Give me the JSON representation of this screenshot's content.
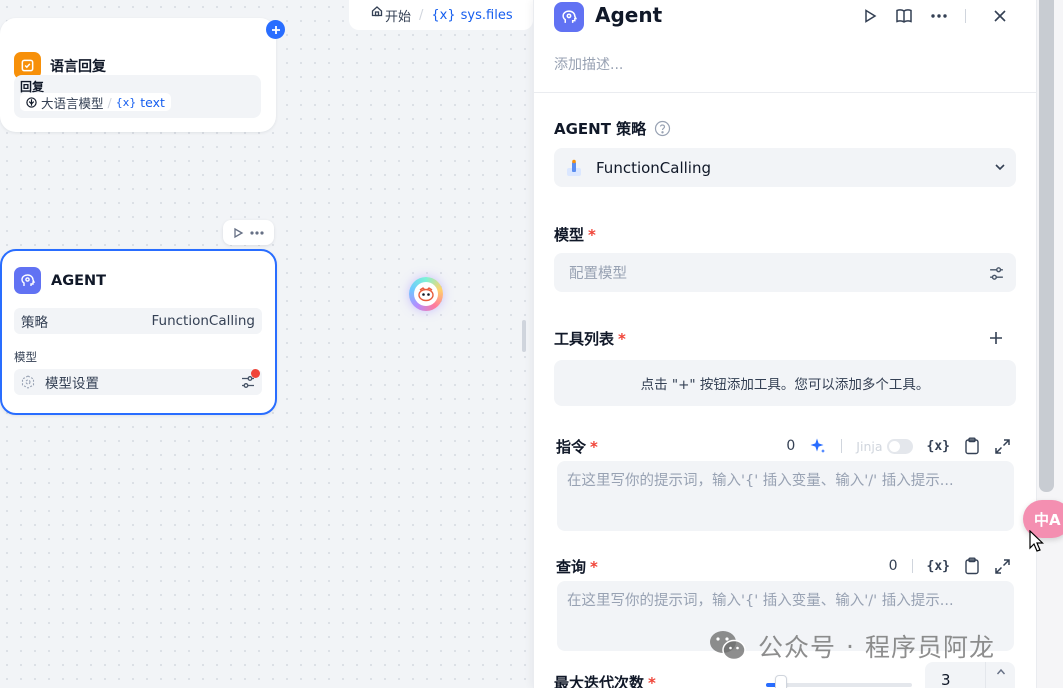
{
  "canvas": {
    "reply_node": {
      "title": "语言回复",
      "reply_label": "回复",
      "source_node": "大语言模型",
      "separator": "/",
      "variable_prefix": "{x}",
      "variable": "text"
    },
    "start_crumb": {
      "label": "开始",
      "separator": "/",
      "variable_prefix": "{x}",
      "variable": "sys.files"
    },
    "agent_node": {
      "title": "AGENT",
      "strategy_label": "策略",
      "strategy_value": "FunctionCalling",
      "model_label": "模型",
      "model_value": "模型设置"
    }
  },
  "panel": {
    "title": "Agent",
    "description_placeholder": "添加描述...",
    "strategy": {
      "label": "AGENT 策略",
      "value": "FunctionCalling"
    },
    "model": {
      "label": "模型",
      "required": "*",
      "placeholder": "配置模型"
    },
    "tools": {
      "label": "工具列表",
      "required": "*",
      "empty_text": "点击 \"+\" 按钮添加工具。您可以添加多个工具。"
    },
    "instruction": {
      "label": "指令",
      "required": "*",
      "count": "0",
      "jinja_label": "Jinja",
      "var_button": "{x}",
      "placeholder": "在这里写你的提示词，输入'{' 插入变量、输入'/' 插入提示..."
    },
    "query": {
      "label": "查询",
      "required": "*",
      "count": "0",
      "var_button": "{x}",
      "placeholder": "在这里写你的提示词，输入'{' 插入变量、输入'/' 插入提示..."
    },
    "max_iterations": {
      "label": "最大迭代次数",
      "required": "*",
      "value": "3"
    }
  },
  "overlay": {
    "translate_label": "中A",
    "watermark": {
      "brand": "公众号",
      "dot": "·",
      "author": "程序员阿龙"
    }
  },
  "colors": {
    "accent": "#296dff",
    "reply_icon": "#f79009",
    "agent_icon": "#6172f3",
    "required": "#f04438"
  },
  "icons": [
    "home-icon",
    "play-icon",
    "book-icon",
    "more-icon",
    "close-icon",
    "help-icon",
    "chevron-down-icon",
    "tune-icon",
    "plus-icon",
    "sparkle-icon",
    "clipboard-icon",
    "expand-icon",
    "wechat-icon"
  ]
}
